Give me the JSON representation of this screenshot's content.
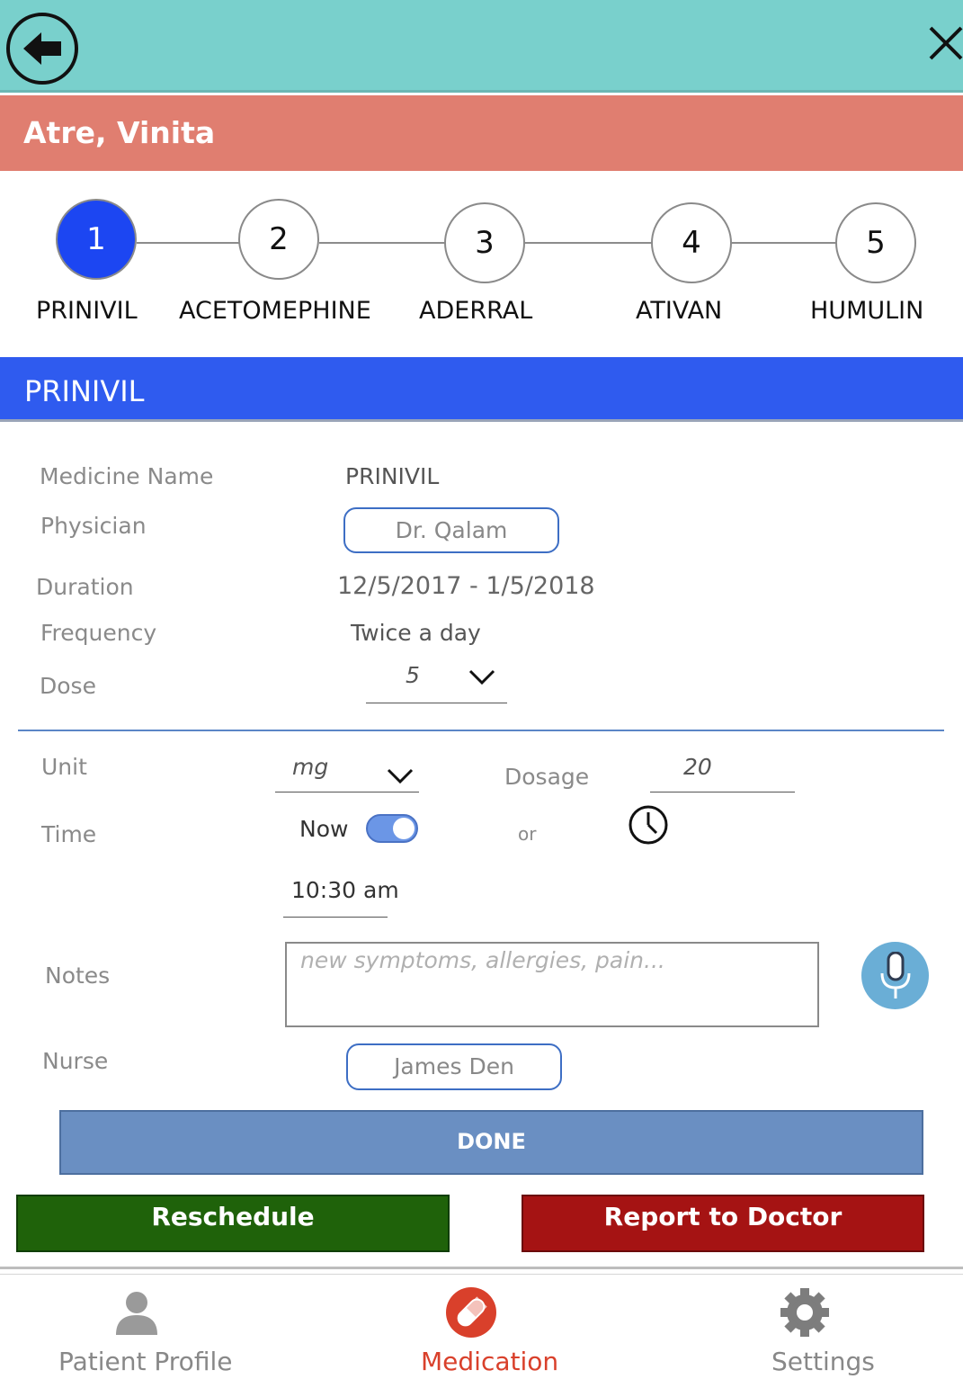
{
  "header": {
    "back_icon": "arrow-left-circle-icon",
    "close_icon": "close-icon",
    "patient_name": "Atre, Vinita"
  },
  "steps": [
    {
      "number": "1",
      "label": "PRINIVIL",
      "active": true
    },
    {
      "number": "2",
      "label": "ACETOMEPHINE",
      "active": false
    },
    {
      "number": "3",
      "label": "ADERRAL",
      "active": false
    },
    {
      "number": "4",
      "label": "ATIVAN",
      "active": false
    },
    {
      "number": "5",
      "label": "HUMULIN",
      "active": false
    }
  ],
  "section": {
    "title": "PRINIVIL"
  },
  "form": {
    "medicine_name_label": "Medicine Name",
    "medicine_name_value": "PRINIVIL",
    "physician_label": "Physician",
    "physician_value": "Dr. Qalam",
    "duration_label": "Duration",
    "duration_value": "12/5/2017 - 1/5/2018",
    "frequency_label": "Frequency",
    "frequency_value": "Twice a day",
    "dose_label": "Dose",
    "dose_value": "5",
    "unit_label": "Unit",
    "unit_value": "mg",
    "dosage_label": "Dosage",
    "dosage_value": "20",
    "time_label": "Time",
    "now_label": "Now",
    "now_toggle_on": true,
    "or_label": "or",
    "time_value": "10:30 am",
    "notes_label": "Notes",
    "notes_placeholder": "new symptoms, allergies, pain...",
    "nurse_label": "Nurse",
    "nurse_value": "James Den"
  },
  "actions": {
    "done": "DONE",
    "reschedule": "Reschedule",
    "report": "Report to Doctor"
  },
  "bottom_nav": [
    {
      "label": "Patient Profile",
      "icon": "person-icon",
      "active": false
    },
    {
      "label": "Medication",
      "icon": "pill-icon",
      "active": true
    },
    {
      "label": "Settings",
      "icon": "gear-icon",
      "active": false
    }
  ],
  "colors": {
    "topbar": "#79d0cc",
    "patient_bar": "#e07e70",
    "accent_blue": "#2f5bef",
    "done": "#6a8fc2",
    "reschedule": "#1f620a",
    "report": "#a51313",
    "active_nav": "#d9402b"
  }
}
